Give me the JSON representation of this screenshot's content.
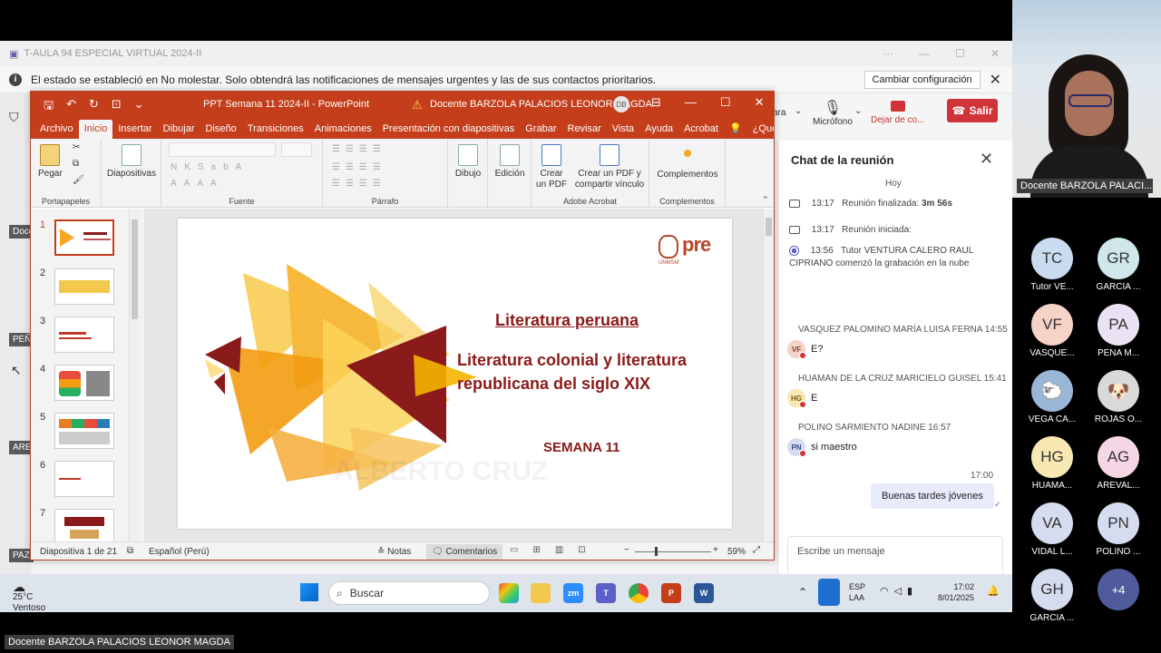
{
  "teams_window": {
    "title": "T-AULA 94 ESPECIAL VIRTUAL 2024-II",
    "notice": "El estado se estableció en No molestar. Solo obtendrá las notificaciones de mensajes urgentes y las de sus contactos prioritarios.",
    "notice_button": "Cambiar configuración",
    "left_labels": [
      "Docen",
      "PEÑ",
      "ARE",
      "PAZ"
    ],
    "toolbar": {
      "share_partial": "ara",
      "mic_label": "Micrófono",
      "leave_label": "Dejar de co...",
      "exit_label": "Salir"
    }
  },
  "chat": {
    "title": "Chat de la reunión",
    "day": "Hoy",
    "events": [
      {
        "time": "13:17",
        "text": "Reunión finalizada:",
        "bold": "3m 56s"
      },
      {
        "time": "13:17",
        "text": "Reunión iniciada:",
        "bold": ""
      },
      {
        "time": "13:56",
        "text": "Tutor VENTURA CALERO RAUL CIPRIANO comenzó la grabación en la nube",
        "bold": ""
      }
    ],
    "messages": [
      {
        "sender": "VASQUEZ PALOMINO MARÍA LUISA FERNA",
        "time": "14:55",
        "initials": "VF",
        "text": "E?",
        "color": "#f6d3c7"
      },
      {
        "sender": "HUAMAN DE LA CRUZ MARICIELO GUISEL",
        "time": "15:41",
        "initials": "HG",
        "text": "E",
        "color": "#f8e8b3"
      },
      {
        "sender": "POLINO SARMIENTO NADINE",
        "time": "16:57",
        "initials": "PN",
        "text": "si maestro",
        "color": "#d6dcf0"
      }
    ],
    "own_time": "17:00",
    "own_message": "Buenas tardes jóvenes",
    "compose_placeholder": "Escribe un mensaje"
  },
  "camera": {
    "label": "Docente BARZOLA PALACI..."
  },
  "participants": [
    {
      "initials": "TC",
      "name": "Tutor VE...",
      "bg": "#c9dcef"
    },
    {
      "initials": "GR",
      "name": "GARCÍA ...",
      "bg": "#cfe7ea"
    },
    {
      "initials": "VF",
      "name": "VASQUE...",
      "bg": "#f6d3c7"
    },
    {
      "initials": "PA",
      "name": "PEÑA M...",
      "bg": "#e9e2f2"
    },
    {
      "initials": "",
      "name": "VEGA CA...",
      "bg": "#9ab6d6"
    },
    {
      "initials": "",
      "name": "ROJAS O...",
      "bg": "#d9d9d9"
    },
    {
      "initials": "HG",
      "name": "HUAMA...",
      "bg": "#f8e8b3"
    },
    {
      "initials": "AG",
      "name": "AREVAL...",
      "bg": "#f5d6e4"
    },
    {
      "initials": "VA",
      "name": "VIDAL L...",
      "bg": "#d6dcf0"
    },
    {
      "initials": "PN",
      "name": "POLINO ...",
      "bg": "#d6dcf0"
    },
    {
      "initials": "GH",
      "name": "GARCIA ...",
      "bg": "#d6dcf0"
    },
    {
      "initials": "+4",
      "name": "",
      "bg": "#4f5b9a"
    }
  ],
  "ppt": {
    "doc_title": "PPT Semana 11 2024-II  -  PowerPoint",
    "user": "Docente BARZOLA PALACIOS LEONOR MAGDA",
    "user_initials": "DB",
    "tabs": [
      "Archivo",
      "Inicio",
      "Insertar",
      "Dibujar",
      "Diseño",
      "Transiciones",
      "Animaciones",
      "Presentación con diapositivas",
      "Grabar",
      "Revisar",
      "Vista",
      "Ayuda",
      "Acrobat",
      "¿Qué des"
    ],
    "ribbon": {
      "pegar": "Pegar",
      "portapapeles": "Portapapeles",
      "diapositivas": "Diapositivas",
      "fuente": "Fuente",
      "parrafo": "Párrafo",
      "dibujo": "Dibujo",
      "edicion": "Edición",
      "crear_pdf": "Crear un PDF",
      "crear_pdf_comp": "Crear un PDF y compartir vínculo",
      "adobe": "Adobe Acrobat",
      "complementos": "Complementos",
      "complementos_grp": "Complementos"
    },
    "slide_numbers": [
      "1",
      "2",
      "3",
      "4",
      "5",
      "6",
      "7"
    ],
    "slide": {
      "title": "Literatura peruana",
      "subtitle": "Literatura colonial y literatura republicana del siglo XIX",
      "week": "SEMANA 11",
      "logo": "pre",
      "logo_sub": "UNMSM",
      "watermark": "ALBERTO CRUZ"
    },
    "status": {
      "slide_of": "Diapositiva 1 de 21",
      "language": "Español (Perú)",
      "notes": "Notas",
      "comments": "Comentarios",
      "zoom": "59%"
    }
  },
  "taskbar": {
    "temp": "25°C",
    "weather": "Ventoso",
    "search": "Buscar",
    "lang1": "ESP",
    "lang2": "LAA",
    "time": "17:02",
    "date": "8/01/2025"
  },
  "bottom_label": "Docente BARZOLA PALACIOS LEONOR MAGDA"
}
